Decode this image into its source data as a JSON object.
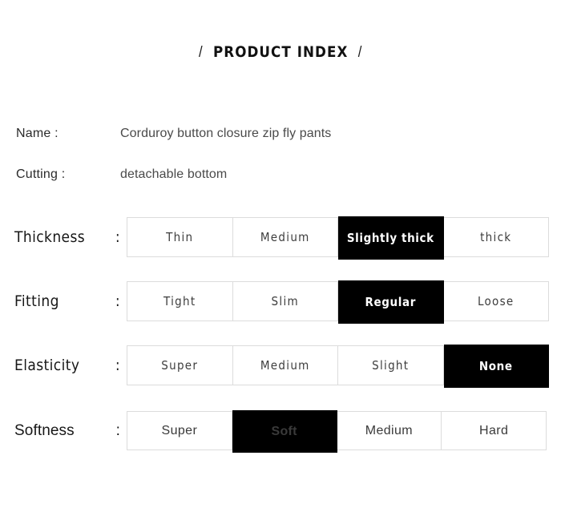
{
  "title": {
    "left_slash": "/",
    "text": "PRODUCT INDEX",
    "right_slash": "/"
  },
  "info": [
    {
      "label": "Name :",
      "value": "Corduroy button closure zip fly pants"
    },
    {
      "label": "Cutting :",
      "value": "detachable bottom"
    }
  ],
  "specs": [
    {
      "label_word": "Thickness",
      "label_colon": ":",
      "options": [
        "Thin",
        "Medium",
        "Slightly thick",
        "thick"
      ],
      "selected": "Slightly thick",
      "selected_index": 2
    },
    {
      "label_word": "Fitting",
      "label_colon": ":",
      "options": [
        "Tight",
        "Slim",
        "Regular",
        "Loose"
      ],
      "selected": "Regular",
      "selected_index": 2
    },
    {
      "label_word": "Elasticity",
      "label_colon": ":",
      "options": [
        "Super",
        "Medium",
        "Slight",
        "None"
      ],
      "selected": "None",
      "selected_index": 3
    },
    {
      "label_word": "Softness",
      "label_colon": ":",
      "options": [
        "Super",
        "Soft",
        "Medium",
        "Hard"
      ],
      "selected": "Soft",
      "selected_index": 1
    }
  ],
  "colors": {
    "background": "#ffffff",
    "border": "#dcdcdc",
    "selected_background": "#000000",
    "selected_text": "#ffffff",
    "label_text": "#171717",
    "option_text": "#3d3d3d",
    "value_text": "#4a4a4a"
  }
}
